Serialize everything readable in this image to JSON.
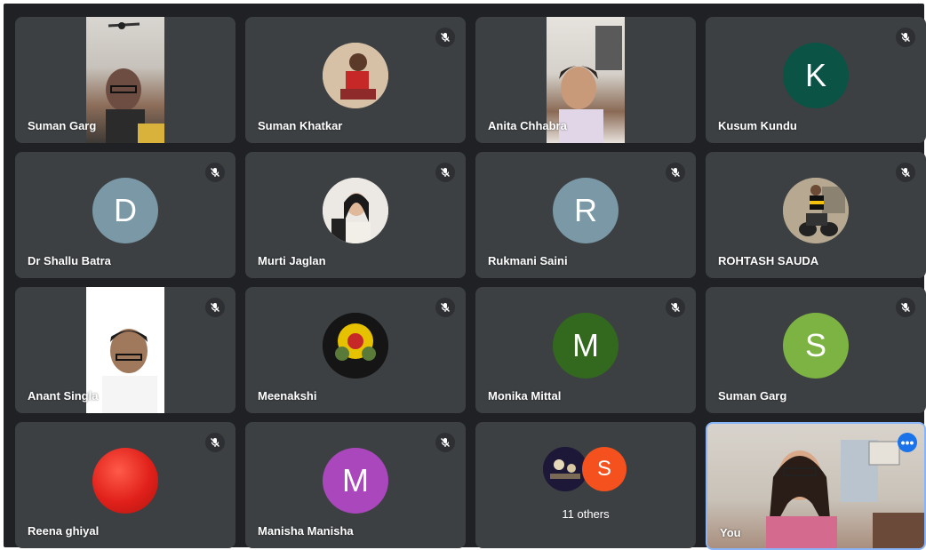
{
  "participants": [
    {
      "name": "Suman Garg",
      "kind": "video",
      "muted": false
    },
    {
      "name": "Suman Khatkar",
      "kind": "photo",
      "muted": true
    },
    {
      "name": "Anita Chhabra",
      "kind": "video",
      "muted": false
    },
    {
      "name": "Kusum Kundu",
      "kind": "initial",
      "initial": "K",
      "color": "#0b5345",
      "muted": true
    },
    {
      "name": "Dr Shallu Batra",
      "kind": "initial",
      "initial": "D",
      "color": "#7b98a6",
      "muted": true
    },
    {
      "name": "Murti Jaglan",
      "kind": "photo",
      "muted": true
    },
    {
      "name": "Rukmani Saini",
      "kind": "initial",
      "initial": "R",
      "color": "#7b98a6",
      "muted": true
    },
    {
      "name": "ROHTASH SAUDA",
      "kind": "photo",
      "muted": true
    },
    {
      "name": "Anant Singla",
      "kind": "video",
      "muted": true
    },
    {
      "name": "Meenakshi",
      "kind": "photo",
      "muted": true
    },
    {
      "name": "Monika Mittal",
      "kind": "initial",
      "initial": "M",
      "color": "#33691e",
      "muted": true
    },
    {
      "name": "Suman Garg",
      "kind": "initial",
      "initial": "S",
      "color": "#7cb342",
      "muted": true
    },
    {
      "name": "Reena ghiyal",
      "kind": "photo",
      "muted": true
    },
    {
      "name": "Manisha Manisha",
      "kind": "initial",
      "initial": "M",
      "color": "#ab47bc",
      "muted": true
    }
  ],
  "others": {
    "label": "11 others",
    "avatar_initial": "S"
  },
  "self": {
    "name": "You"
  },
  "icons": {
    "mic_off": "mic-off-icon",
    "more": "more-options-icon"
  },
  "colors": {
    "tile": "#3c4043",
    "background": "#202124",
    "self_border": "#8ab4f8"
  }
}
